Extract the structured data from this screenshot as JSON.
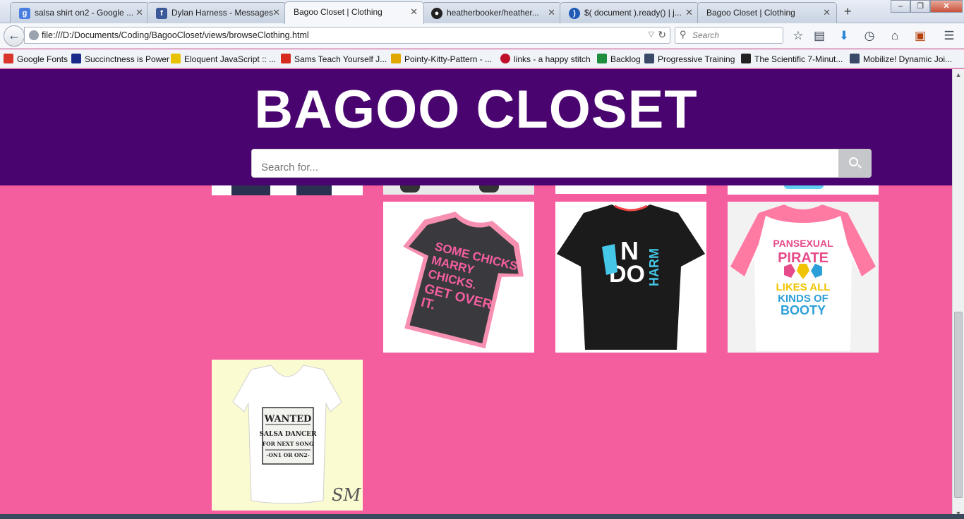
{
  "browser": {
    "tabs": [
      {
        "label": "salsa shirt on2 - Google ...",
        "favicon": "google-icon",
        "color": "#4a7ee0"
      },
      {
        "label": "Dylan Harness - Messages",
        "favicon": "facebook-icon",
        "color": "#3b5998"
      },
      {
        "label": "Bagoo Closet | Clothing",
        "favicon": "",
        "color": ""
      },
      {
        "label": "heatherbooker/heather...",
        "favicon": "github-icon",
        "color": "#222222"
      },
      {
        "label": "$( document ).ready() | j...",
        "favicon": "jquery-icon",
        "color": "#1f5bb5"
      },
      {
        "label": "Bagoo Closet | Clothing",
        "favicon": "",
        "color": ""
      }
    ],
    "new_tab": "+",
    "url": "file:///D:/Documents/Coding/BagooCloset/views/browseClothing.html",
    "search_placeholder": "Search",
    "bookmarks": [
      {
        "label": "Google Fonts",
        "color": "#d9352a"
      },
      {
        "label": "Succinctness is Power",
        "color": "#1a2a8a"
      },
      {
        "label": "Eloquent JavaScript :: ...",
        "color": "#e8c200"
      },
      {
        "label": "Sams Teach Yourself J...",
        "color": "#d62b1f"
      },
      {
        "label": "Pointy-Kitty-Pattern - ...",
        "color": "#e0a800"
      },
      {
        "label": "links - a happy stitch",
        "color": "#c0102a"
      },
      {
        "label": "Backlog",
        "color": "#1e8e3e"
      },
      {
        "label": "Progressive Training",
        "color": "#3c4a6a"
      },
      {
        "label": "The Scientific 7-Minut...",
        "color": "#222222"
      },
      {
        "label": "Mobilize! Dynamic Joi...",
        "color": "#3c4a6a"
      }
    ]
  },
  "site": {
    "title": "BAGOO CLOSET",
    "search_placeholder": "Search for...",
    "header_color": "#4a0470",
    "background_color": "#f45e9f"
  },
  "products": [
    {
      "name": "some-chicks-marry-chicks-shirt",
      "text": "SOME CHICKS MARRY CHICKS. GET OVER IT."
    },
    {
      "name": "no-do-harm-shirt",
      "text": "NO DO HARM"
    },
    {
      "name": "pansexual-pirate-shirt",
      "text": "PANSEXUAL PIRATE LIKES ALL KINDS OF BOOTY"
    },
    {
      "name": "wanted-salsa-dancer-shirt",
      "text": "WANTED SALSA DANCER FOR NEXT SONG -ON1 OR ON2-",
      "signature": "SM"
    }
  ]
}
